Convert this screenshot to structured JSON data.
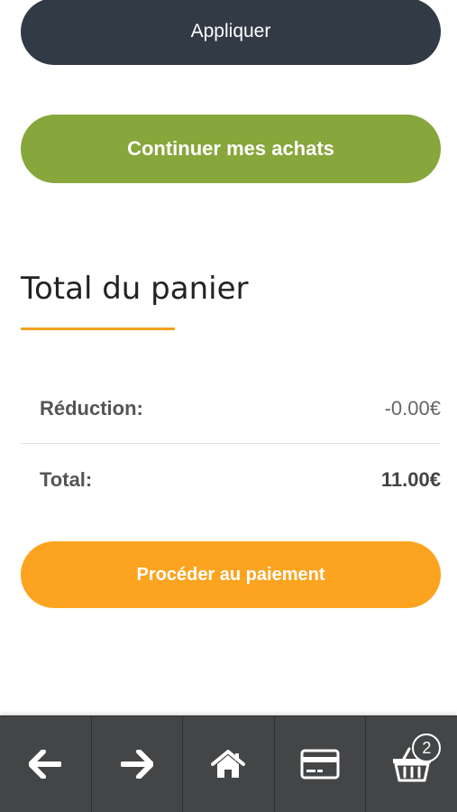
{
  "buttons": {
    "apply_label": "Appliquer",
    "continue_label": "Continuer mes achats",
    "checkout_label": "Procéder au paiement"
  },
  "cart_totals": {
    "title": "Total du panier",
    "discount_label": "Réduction:",
    "discount_value": "-0.00€",
    "total_label": "Total:",
    "total_value": "11.00€"
  },
  "bottom_nav": {
    "items": [
      {
        "icon": "arrow-left-icon"
      },
      {
        "icon": "arrow-right-icon"
      },
      {
        "icon": "home-icon"
      },
      {
        "icon": "credit-card-icon"
      },
      {
        "icon": "basket-icon"
      }
    ],
    "cart_count": "2"
  },
  "colors": {
    "apply": "#323a45",
    "continue": "#87a63c",
    "checkout": "#fca41f",
    "accent_underline": "#f2a223",
    "nav_bg": "#434547"
  }
}
